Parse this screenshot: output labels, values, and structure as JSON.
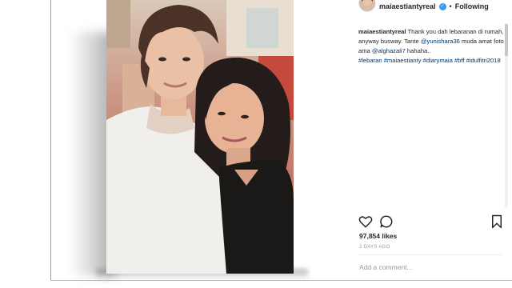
{
  "post": {
    "username": "maiaestiantyreal",
    "verified": true,
    "separator": "•",
    "follow_status": "Following",
    "caption": {
      "username": "maiaestiantyreal",
      "line1": "Thank you dah lebaranan di rumah, anyway busway. Tante ",
      "mention1": "@yunishara36",
      "line2": " muda amat foto ama ",
      "mention2": "@alghazali7",
      "line3": " hahaha..",
      "hashtags": [
        "#lebaran",
        "#maiaestianty",
        "#diarymaia",
        "#bff",
        "#idulfitri2018"
      ]
    },
    "likes": "97,854 likes",
    "timestamp": "2 DAYS AGO",
    "comment_placeholder": "Add a comment..."
  },
  "icons": {
    "like": "heart-icon",
    "comment": "comment-bubble-icon",
    "save": "bookmark-icon",
    "verified": "verified-badge-icon"
  },
  "colors": {
    "verified_blue": "#3897f0",
    "link": "#003569",
    "muted": "#999999",
    "text": "#262626"
  }
}
